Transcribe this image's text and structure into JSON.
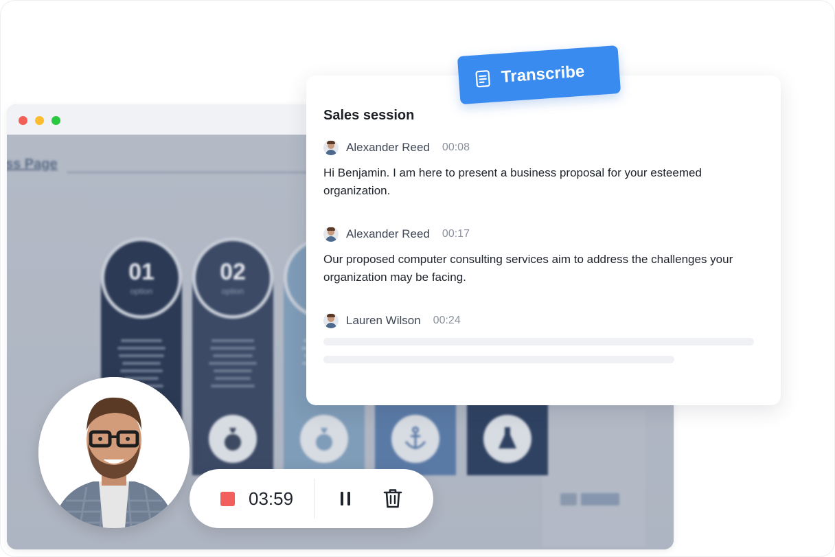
{
  "transcribe_button": {
    "label": "Transcribe",
    "icon": "document-icon",
    "color": "#3a8bef"
  },
  "card": {
    "title": "Sales session",
    "entries": [
      {
        "speaker": "Alexander Reed",
        "time": "00:08",
        "text": "Hi Benjamin. I am here to present a business proposal for your esteemed organization."
      },
      {
        "speaker": "Alexander Reed",
        "time": "00:17",
        "text": "Our proposed computer consulting services aim to address the challenges your organization may be facing."
      },
      {
        "speaker": "Lauren Wilson",
        "time": "00:24",
        "text": ""
      }
    ]
  },
  "slide": {
    "title": "ss Page",
    "columns": [
      {
        "number": "01",
        "label": "option",
        "icon": "lightbulb-icon",
        "color": "#2c3a55"
      },
      {
        "number": "02",
        "label": "option",
        "icon": "money-bag-icon",
        "color": "#3c4a66"
      },
      {
        "number": "",
        "label": "",
        "icon": "money-bag-icon",
        "color": "#7f9cb8"
      },
      {
        "number": "",
        "label": "",
        "icon": "anchor-icon",
        "color": "#5a7aa6"
      },
      {
        "number": "",
        "label": "",
        "icon": "flask-icon",
        "color": "#2f4262"
      }
    ]
  },
  "recorder": {
    "time": "03:59",
    "stop_color": "#f1605c",
    "pause_icon": "pause-icon",
    "delete_icon": "trash-icon"
  },
  "window_controls": {
    "close_color": "#f35f57",
    "minimize_color": "#fbbc2e",
    "maximize_color": "#2ac840"
  }
}
